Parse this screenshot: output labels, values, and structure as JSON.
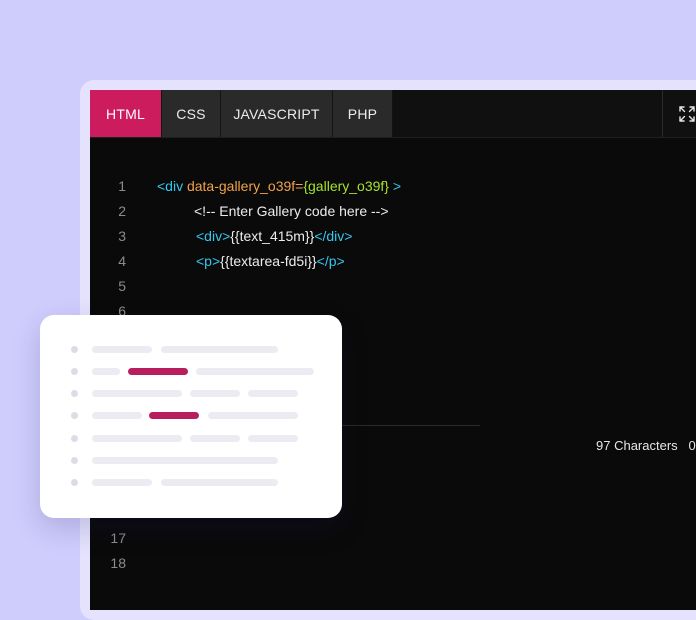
{
  "tabs": [
    {
      "label": "HTML",
      "active": true
    },
    {
      "label": "CSS",
      "active": false
    },
    {
      "label": "JAVASCRIPT",
      "active": false
    },
    {
      "label": "PHP",
      "active": false
    }
  ],
  "fullscreen_icon": "expand-icon",
  "line_numbers": [
    "1",
    "2",
    "3",
    "4",
    "5",
    "6",
    "17",
    "18"
  ],
  "code": {
    "line1": {
      "tag_open": "<div ",
      "attr": "data-gallery_o39f=",
      "value": "{gallery_o39f}",
      "tag_close": " >"
    },
    "line2": {
      "comment": "<!-- Enter Gallery code here -->"
    },
    "line3": {
      "tag_open": "<div>",
      "text": "{{text_415m}}",
      "tag_close": "</div>"
    },
    "line4": {
      "tag_open": "<p>",
      "text": "{{textarea-fd5i}}",
      "tag_close": "</p>"
    }
  },
  "status": {
    "characters": "97 Characters",
    "extra": "0"
  },
  "colors": {
    "background": "#cfcdfc",
    "accent": "#cc1c5d",
    "editor": "#0a0a0a",
    "tag": "#35c7ee",
    "attribute": "#f0a24a",
    "value": "#a6e22e"
  }
}
